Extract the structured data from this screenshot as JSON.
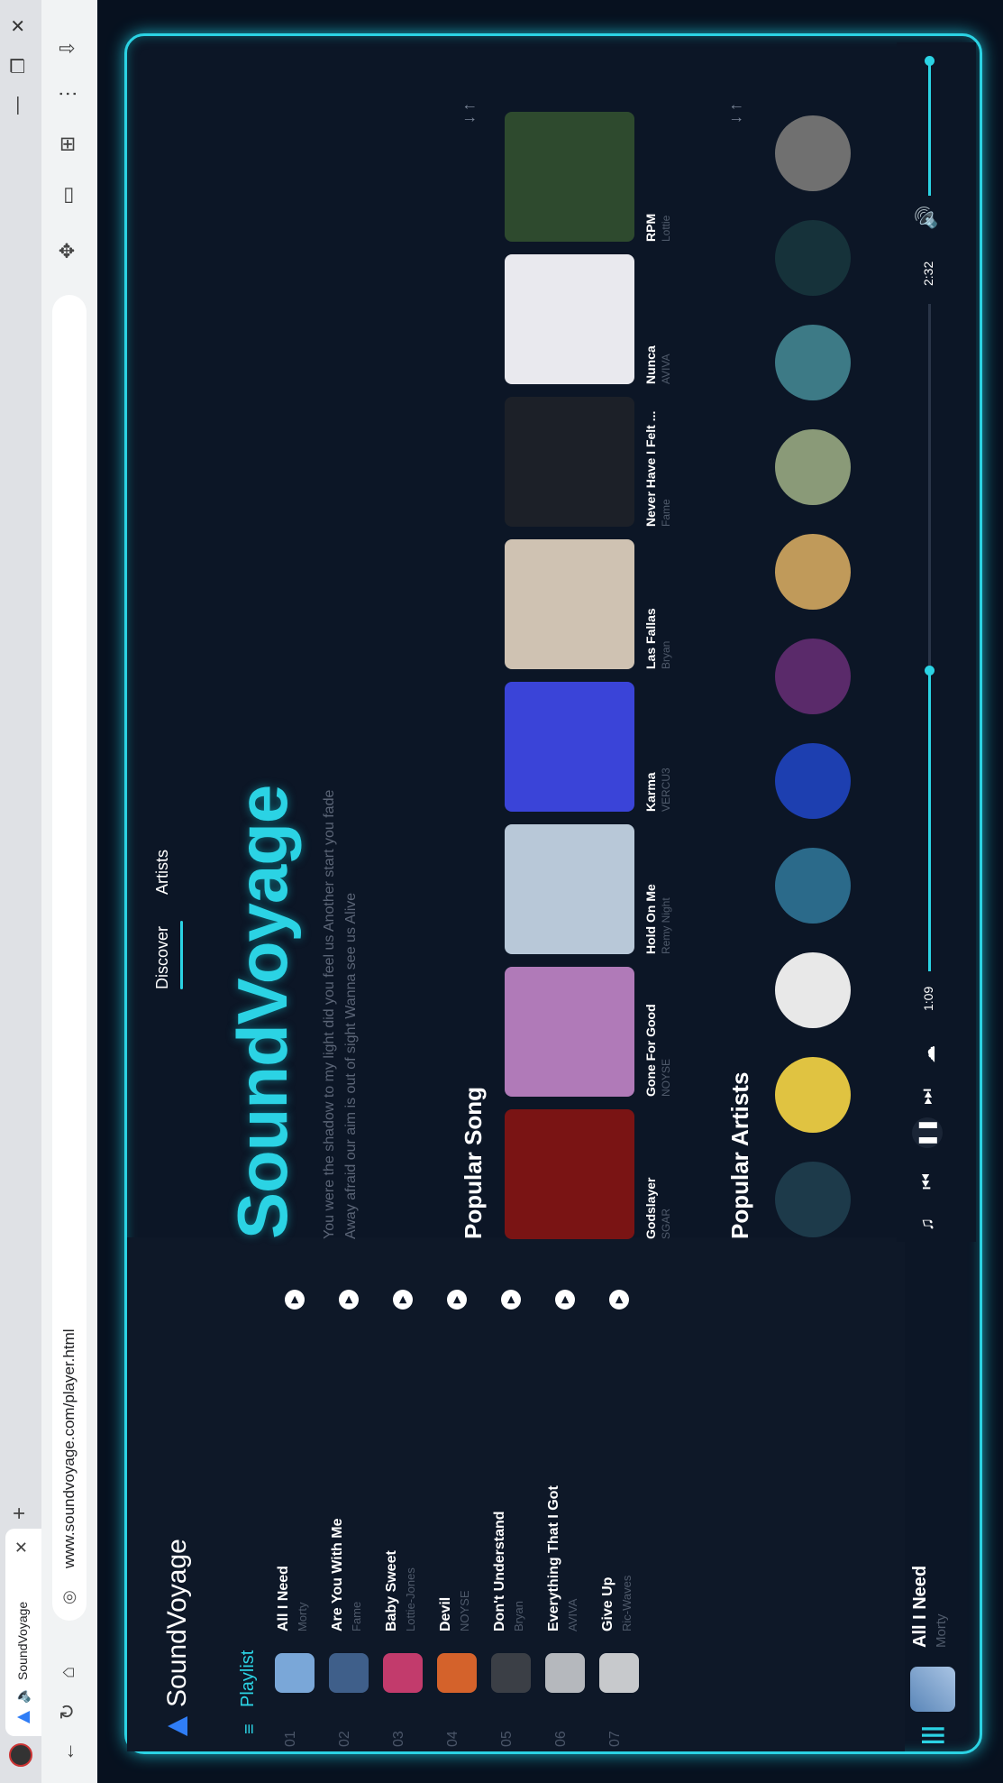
{
  "browser": {
    "tab_title": "SoundVoyage",
    "url": "www.soundvoyage.com/player.html",
    "new_tab": "+",
    "tab_close": "✕",
    "minimize": "—",
    "restore": "❐",
    "close": "✕"
  },
  "app": {
    "brand": "SoundVoyage",
    "playlist_title": "Playlist",
    "playlist": [
      {
        "num": "01",
        "title": "All I Need",
        "artist": "Morty",
        "color": "#7aa7d8"
      },
      {
        "num": "02",
        "title": "Are You With Me",
        "artist": "Fame",
        "color": "#3f5f8a"
      },
      {
        "num": "03",
        "title": "Baby Sweet",
        "artist": "Lottie-Jones",
        "color": "#c23b6c"
      },
      {
        "num": "04",
        "title": "Devil",
        "artist": "NOYSE",
        "color": "#d4622b"
      },
      {
        "num": "05",
        "title": "Don't Understand",
        "artist": "Bryan",
        "color": "#3b3f46"
      },
      {
        "num": "06",
        "title": "Everything That I Got",
        "artist": "AVIVA",
        "color": "#b5b8bd"
      },
      {
        "num": "07",
        "title": "Give Up",
        "artist": "Ric-Waves",
        "color": "#c7c9cc"
      }
    ],
    "nav": {
      "discover": "Discover",
      "artists": "Artists"
    },
    "hero_title": "SoundVoyage",
    "tagline_1": "You were the shadow to my light did you feel us Another start you fade",
    "tagline_2": "Away afraid our aim is out of sight Wanna see us Alive",
    "popular_song_title": "Popular Song",
    "popular_artists_title": "Popular Artists",
    "songs": [
      {
        "title": "Godslayer",
        "artist": "SGAR",
        "color": "#7a1414"
      },
      {
        "title": "Gone For Good",
        "artist": "NOYSE",
        "color": "#b07ab8"
      },
      {
        "title": "Hold On Me",
        "artist": "Remy Night",
        "color": "#b8c8d8"
      },
      {
        "title": "Karma",
        "artist": "VERCU3",
        "color": "#3a44d8"
      },
      {
        "title": "Las Fallas",
        "artist": "Bryan",
        "color": "#cfc2b2"
      },
      {
        "title": "Never Have I Felt ...",
        "artist": "Fame",
        "color": "#1c2028"
      },
      {
        "title": "Nunca",
        "artist": "AVIVA",
        "color": "#e9e9ee"
      },
      {
        "title": "RPM",
        "artist": "Lottie",
        "color": "#2e4a2e"
      }
    ],
    "artists": [
      {
        "color": "#1d3a4a"
      },
      {
        "color": "#e0c341"
      },
      {
        "color": "#e8e8e8"
      },
      {
        "color": "#2b6a8a"
      },
      {
        "color": "#1d3fb0"
      },
      {
        "color": "#5a2a6a"
      },
      {
        "color": "#c09a5a"
      },
      {
        "color": "#8a9a78"
      },
      {
        "color": "#3d7a86"
      },
      {
        "color": "#16323a"
      },
      {
        "color": "#707070"
      }
    ],
    "player": {
      "now_title": "All I Need",
      "now_artist": "Morty",
      "current_time": "1:09",
      "total_time": "2:32",
      "progress": 0.45,
      "volume": 1.0
    },
    "icons": {
      "menu": "menu-icon",
      "playlist": "playlist-icon",
      "prev": "skip-previous-icon",
      "pause": "pause-icon",
      "next": "skip-next-icon",
      "download": "download-icon",
      "volume": "volume-icon"
    }
  }
}
